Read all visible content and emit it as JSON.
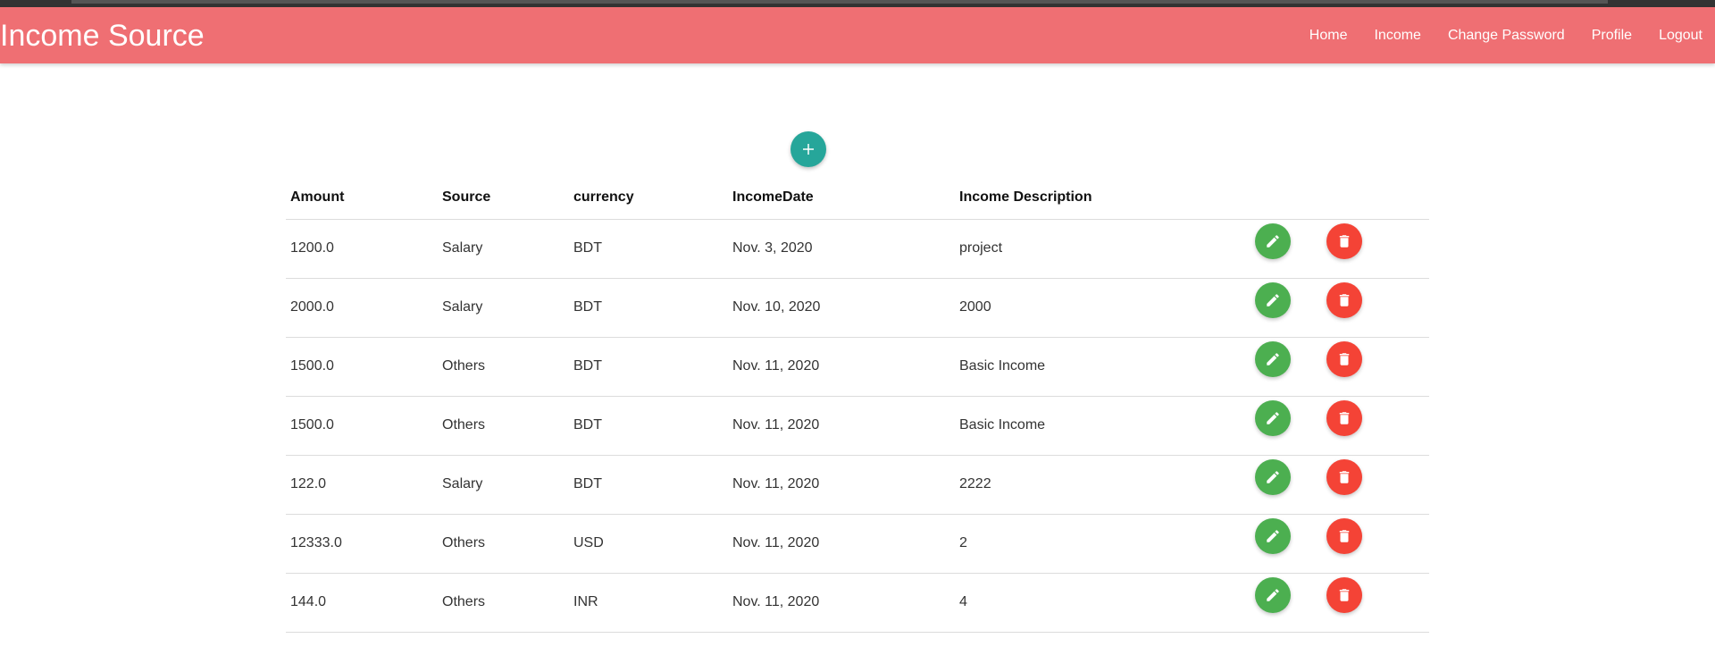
{
  "navbar": {
    "brand": "Income Source",
    "links": [
      "Home",
      "Income",
      "Change Password",
      "Profile",
      "Logout"
    ]
  },
  "add_button": {
    "icon": "plus-icon",
    "color": "#26a69a"
  },
  "table": {
    "headers": [
      "Amount",
      "Source",
      "currency",
      "IncomeDate",
      "Income Description"
    ],
    "rows": [
      [
        "1200.0",
        "Salary",
        "BDT",
        "Nov. 3, 2020",
        "project"
      ],
      [
        "2000.0",
        "Salary",
        "BDT",
        "Nov. 10, 2020",
        "2000"
      ],
      [
        "1500.0",
        "Others",
        "BDT",
        "Nov. 11, 2020",
        "Basic Income"
      ],
      [
        "1500.0",
        "Others",
        "BDT",
        "Nov. 11, 2020",
        "Basic Income"
      ],
      [
        "122.0",
        "Salary",
        "BDT",
        "Nov. 11, 2020",
        "2222"
      ],
      [
        "12333.0",
        "Others",
        "USD",
        "Nov. 11, 2020",
        "2"
      ],
      [
        "144.0",
        "Others",
        "INR",
        "Nov. 11, 2020",
        "4"
      ]
    ],
    "row_actions": [
      {
        "name": "edit",
        "icon": "pencil-icon",
        "color": "#4caf50"
      },
      {
        "name": "delete",
        "icon": "trash-icon",
        "color": "#f44336"
      }
    ]
  },
  "colors": {
    "navbar": "#ef6f73",
    "accent": "#26a69a"
  }
}
